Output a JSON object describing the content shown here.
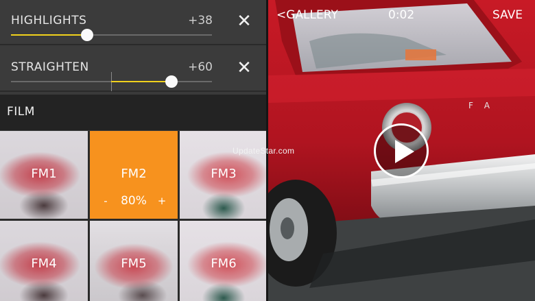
{
  "adjustments": [
    {
      "label": "HIGHLIGHTS",
      "value": "+38",
      "level": 0.38
    },
    {
      "label": "STRAIGHTEN",
      "value": "+60",
      "level": 0.6
    }
  ],
  "film": {
    "title": "FILM",
    "tiles": [
      {
        "label": "FM1"
      },
      {
        "label": "FM2",
        "intensity": "80%",
        "minus": "-",
        "plus": "+"
      },
      {
        "label": "FM3"
      },
      {
        "label": "FM4"
      },
      {
        "label": "FM5"
      },
      {
        "label": "FM6"
      }
    ]
  },
  "preview": {
    "back_label": "GALLERY",
    "time": "0:02",
    "save_label": "SAVE"
  },
  "watermark": "UpdateStar.com",
  "colors": {
    "accent_yellow": "#f2d21c",
    "active_tile": "#f7921e",
    "car_red": "#b3141e"
  }
}
